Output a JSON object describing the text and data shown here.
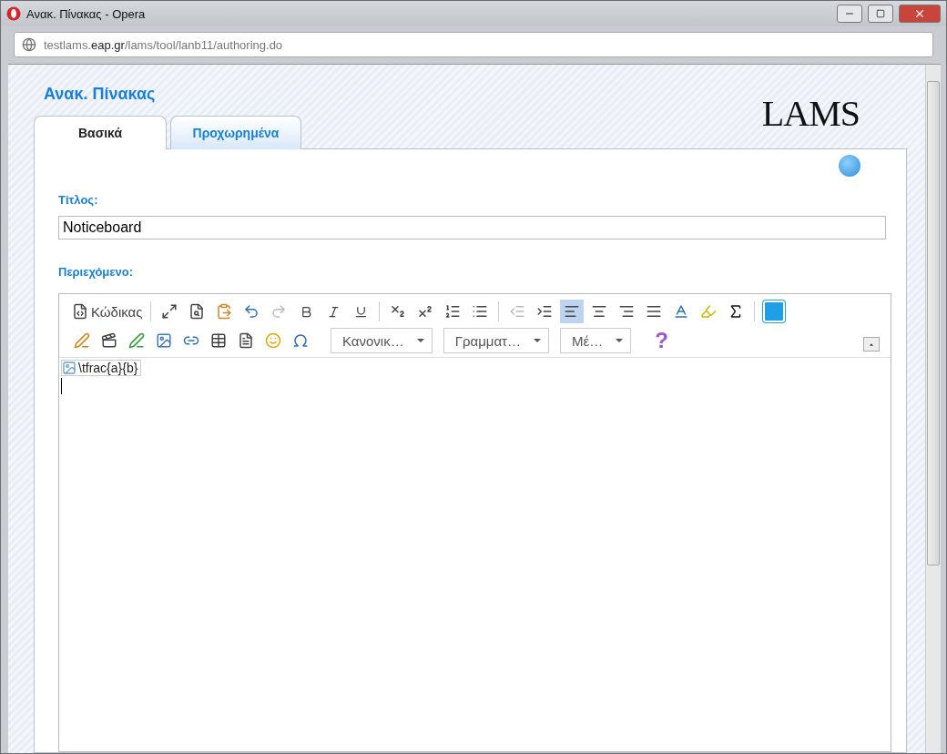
{
  "window": {
    "title": "Ανακ. Πίνακας - Opera"
  },
  "address": {
    "host_start": "testlams.",
    "host_main": "eap.gr",
    "path": "/lams/tool/lanb11/authoring.do"
  },
  "page_title": "Ανακ. Πίνακας",
  "logo": "LAMS",
  "tabs": [
    {
      "label": "Βασικά",
      "selected": true
    },
    {
      "label": "Προχωρημένα",
      "selected": false
    }
  ],
  "title_field": {
    "label": "Τίτλος:",
    "value": "Noticeboard"
  },
  "content_label": "Περιεχόμενο:",
  "editor": {
    "source_label": "Κώδικας",
    "align_buttons": [
      {
        "selected": true
      },
      {
        "selected": false
      },
      {
        "selected": false
      },
      {
        "selected": false
      }
    ],
    "dropdowns": [
      {
        "value": "Κανονικ…"
      },
      {
        "value": "Γραμματ…"
      },
      {
        "value": "Μέ…"
      }
    ],
    "help": "?",
    "image_alt": "\\tfrac{a}{b}"
  }
}
